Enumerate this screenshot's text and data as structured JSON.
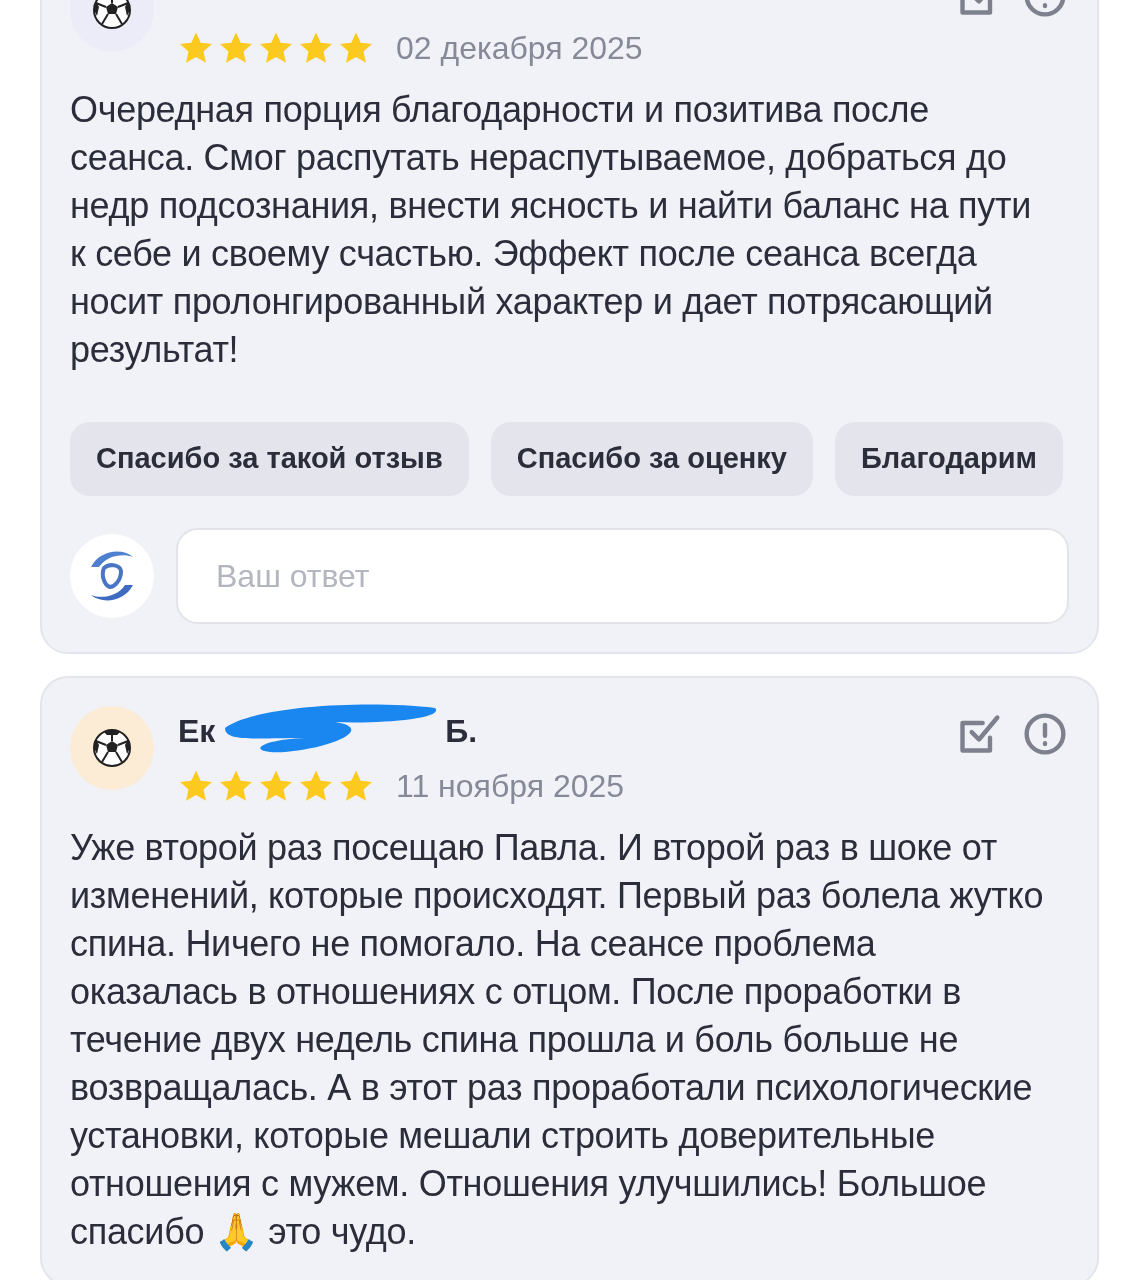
{
  "reviews": [
    {
      "stars": 5,
      "date": "02 декабря 2025",
      "text": "Очередная порция благодарности и позитива после сеанса. Смог распутать нераспутываемое, добраться до недр подсознания, внести ясность и найти баланс на пути к себе и своему счастью. Эффект после сеанса всегда носит пролонгированный характер и дает потрясающий результат!",
      "quick_replies": [
        "Спасибо за такой отзыв",
        "Спасибо за оценку",
        "Благодарим"
      ],
      "reply": {
        "placeholder": "Ваш ответ"
      }
    },
    {
      "author": {
        "name_start": "Ек",
        "name_end": "Б."
      },
      "stars": 5,
      "date": "11 ноября 2025",
      "text": "Уже второй раз посещаю Павла. И второй раз в шоке от изменений, которые происходят. Первый раз болела жутко спина. Ничего не помогало. На сеансе проблема оказалась в отношениях с отцом. После проработки в течение двух недель спина прошла и боль больше не возвращалась. А в этот раз проработали психологические установки, которые мешали строить доверительные отношения с мужем. Отношения улучшились! Большое спасибо 🙏 это чудо."
    }
  ]
}
